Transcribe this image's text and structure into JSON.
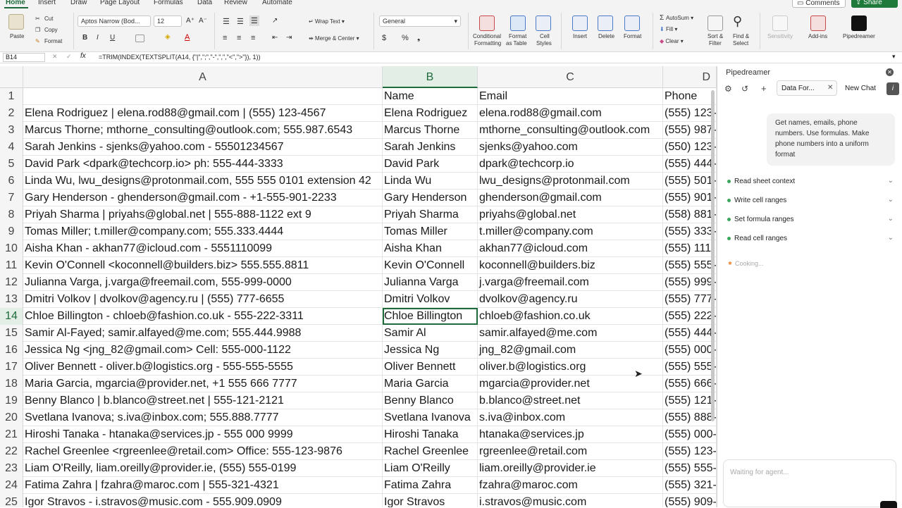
{
  "menu": {
    "tabs": [
      "Home",
      "Insert",
      "Draw",
      "Page Layout",
      "Formulas",
      "Data",
      "Review",
      "Automate"
    ],
    "comments": "Comments",
    "share": "Share"
  },
  "ribbon": {
    "paste": "Paste",
    "cut": "Cut",
    "copy": "Copy",
    "format": "Format",
    "font_name": "Aptos Narrow (Bod...",
    "font_size": "12",
    "wrap_text": "Wrap Text",
    "merge_center": "Merge & Center",
    "number_format": "General",
    "conditional": [
      "Conditional",
      "Formatting"
    ],
    "format_table": [
      "Format",
      "as Table"
    ],
    "cell_styles": [
      "Cell",
      "Styles"
    ],
    "insert": "Insert",
    "delete": "Delete",
    "format2": "Format",
    "autosum": "AutoSum",
    "fill": "Fill",
    "clear": "Clear",
    "sort_filter": [
      "Sort &",
      "Filter"
    ],
    "find_select": [
      "Find &",
      "Select"
    ],
    "sensitivity": "Sensitivity",
    "addins": "Add-ins",
    "pipedreamer": "Pipedreamer",
    "bold": "B",
    "italic": "I",
    "underline": "U",
    "currency": "$",
    "percent": "%"
  },
  "formula_bar": {
    "name_box": "B14",
    "fx": "fx",
    "formula": "=TRIM(INDEX(TEXTSPLIT(A14, {\"|\",\";\",\"-\",\",\",\"<\",\">\"}), 1))"
  },
  "columns": [
    "A",
    "B",
    "C",
    "D"
  ],
  "rows": [
    {
      "n": "1",
      "a": "",
      "b": "Name",
      "c": "Email",
      "d": "Phone"
    },
    {
      "n": "2",
      "a": "Elena Rodriguez | elena.rod88@gmail.com | (555) 123-4567",
      "b": "Elena Rodriguez",
      "c": "elena.rod88@gmail.com",
      "d": "(555) 123-"
    },
    {
      "n": "3",
      "a": "Marcus Thorne; mthorne_consulting@outlook.com; 555.987.6543",
      "b": "Marcus Thorne",
      "c": "mthorne_consulting@outlook.com",
      "d": "(555) 987-"
    },
    {
      "n": "4",
      "a": "Sarah Jenkins - sjenks@yahoo.com - 55501234567",
      "b": "Sarah Jenkins",
      "c": "sjenks@yahoo.com",
      "d": "(550) 123-"
    },
    {
      "n": "5",
      "a": "David Park <dpark@techcorp.io> ph: 555-444-3333",
      "b": "David Park",
      "c": "dpark@techcorp.io",
      "d": "(555) 444-"
    },
    {
      "n": "6",
      "a": "Linda Wu, lwu_designs@protonmail.com, 555 555 0101 extension 42",
      "b": "Linda Wu",
      "c": "lwu_designs@protonmail.com",
      "d": "(555) 501-"
    },
    {
      "n": "7",
      "a": "Gary Henderson - ghenderson@gmail.com - +1-555-901-2233",
      "b": "Gary Henderson",
      "c": "ghenderson@gmail.com",
      "d": "(555) 901-"
    },
    {
      "n": "8",
      "a": "Priyah Sharma | priyahs@global.net | 555-888-1122 ext 9",
      "b": "Priyah Sharma",
      "c": "priyahs@global.net",
      "d": "(558) 881-"
    },
    {
      "n": "9",
      "a": "Tomas Miller; t.miller@company.com; 555.333.4444",
      "b": "Tomas Miller",
      "c": "t.miller@company.com",
      "d": "(555) 333-"
    },
    {
      "n": "10",
      "a": "Aisha Khan - akhan77@icloud.com - 5551110099",
      "b": "Aisha Khan",
      "c": "akhan77@icloud.com",
      "d": "(555) 111-"
    },
    {
      "n": "11",
      "a": "Kevin O'Connell <koconnell@builders.biz> 555.555.8811",
      "b": "Kevin O'Connell",
      "c": "koconnell@builders.biz",
      "d": "(555) 555-"
    },
    {
      "n": "12",
      "a": "Julianna Varga, j.varga@freemail.com, 555-999-0000",
      "b": "Julianna Varga",
      "c": "j.varga@freemail.com",
      "d": "(555) 999-"
    },
    {
      "n": "13",
      "a": "Dmitri Volkov | dvolkov@agency.ru | (555) 777-6655",
      "b": "Dmitri Volkov",
      "c": "dvolkov@agency.ru",
      "d": "(555) 777-"
    },
    {
      "n": "14",
      "a": "Chloe Billington - chloeb@fashion.co.uk - 555-222-3311",
      "b": "Chloe Billington",
      "c": "chloeb@fashion.co.uk",
      "d": "(555) 222-"
    },
    {
      "n": "15",
      "a": "Samir Al-Fayed; samir.alfayed@me.com; 555.444.9988",
      "b": "Samir Al",
      "c": "samir.alfayed@me.com",
      "d": "(555) 444-"
    },
    {
      "n": "16",
      "a": "Jessica Ng <jng_82@gmail.com> Cell: 555-000-1122",
      "b": "Jessica Ng",
      "c": "jng_82@gmail.com",
      "d": "(555) 000-"
    },
    {
      "n": "17",
      "a": "Oliver Bennett - oliver.b@logistics.org - 555-555-5555",
      "b": "Oliver Bennett",
      "c": "oliver.b@logistics.org",
      "d": "(555) 555-"
    },
    {
      "n": "18",
      "a": "Maria Garcia, mgarcia@provider.net, +1 555 666 7777",
      "b": "Maria Garcia",
      "c": "mgarcia@provider.net",
      "d": "(555) 666-"
    },
    {
      "n": "19",
      "a": "Benny Blanco | b.blanco@street.net | 555-121-2121",
      "b": "Benny Blanco",
      "c": "b.blanco@street.net",
      "d": "(555) 121-"
    },
    {
      "n": "20",
      "a": "Svetlana Ivanova; s.iva@inbox.com; 555.888.7777",
      "b": "Svetlana Ivanova",
      "c": "s.iva@inbox.com",
      "d": "(555) 888-"
    },
    {
      "n": "21",
      "a": "Hiroshi Tanaka - htanaka@services.jp - 555 000 9999",
      "b": "Hiroshi Tanaka",
      "c": "htanaka@services.jp",
      "d": "(555) 000-"
    },
    {
      "n": "22",
      "a": "Rachel Greenlee <rgreenlee@retail.com> Office: 555-123-9876",
      "b": "Rachel Greenlee",
      "c": "rgreenlee@retail.com",
      "d": "(555) 123-"
    },
    {
      "n": "23",
      "a": "Liam O'Reilly, liam.oreilly@provider.ie, (555) 555-0199",
      "b": "Liam O'Reilly",
      "c": "liam.oreilly@provider.ie",
      "d": "(555) 555-"
    },
    {
      "n": "24",
      "a": "Fatima Zahra | fzahra@maroc.com | 555-321-4321",
      "b": "Fatima Zahra",
      "c": "fzahra@maroc.com",
      "d": "(555) 321-"
    },
    {
      "n": "25",
      "a": "Igor Stravos - i.stravos@music.com - 555.909.0909",
      "b": "Igor Stravos",
      "c": "i.stravos@music.com",
      "d": "(555) 909-"
    }
  ],
  "selection": {
    "row": "14",
    "col": "B"
  },
  "pane": {
    "title": "Pipedreamer",
    "tab_label": "Data For...",
    "new_chat": "New Chat",
    "prompt": "Get names, emails, phone numbers. Use formulas. Make phone numbers into a uniform format",
    "steps": [
      "Read sheet context",
      "Write cell ranges",
      "Set formula ranges",
      "Read cell ranges"
    ],
    "status": "Cooking...",
    "input_placeholder": "Waiting for agent..."
  },
  "colors": {
    "accent": "#1d6b3a",
    "ok": "#3ba55c",
    "status": "#e8893a"
  }
}
